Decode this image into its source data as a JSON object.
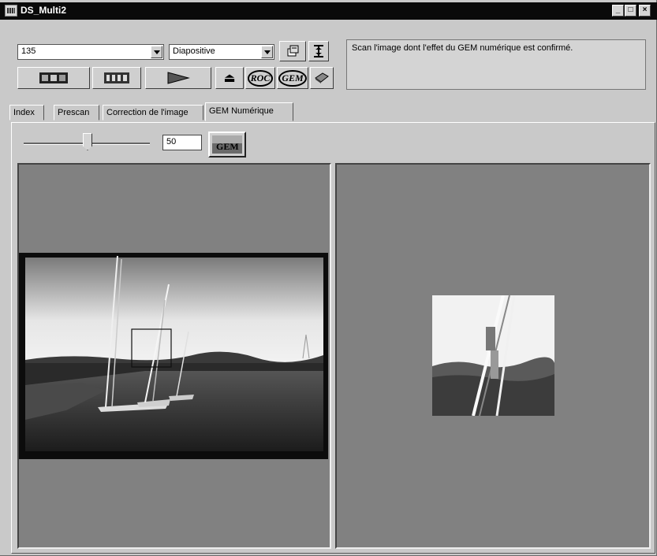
{
  "window": {
    "title": "DS_Multi2",
    "minimize_glyph": "_",
    "maximize_glyph": "□",
    "close_glyph": "×"
  },
  "toolbar": {
    "film_format": "135",
    "film_type": "Diapositive",
    "status_message": "Scan l'image dont l'effet du GEM numérique est confirmé.",
    "roc_label": "ROC",
    "gem_label": "GEM",
    "eject_glyph": "⏏"
  },
  "tabs": [
    "Index",
    "Prescan",
    "Correction de l'image",
    "GEM Numérique"
  ],
  "active_tab": "GEM Numérique",
  "gem_panel": {
    "level_value": "50",
    "level_fraction": 0.5,
    "gem_button_label": "GEM"
  }
}
